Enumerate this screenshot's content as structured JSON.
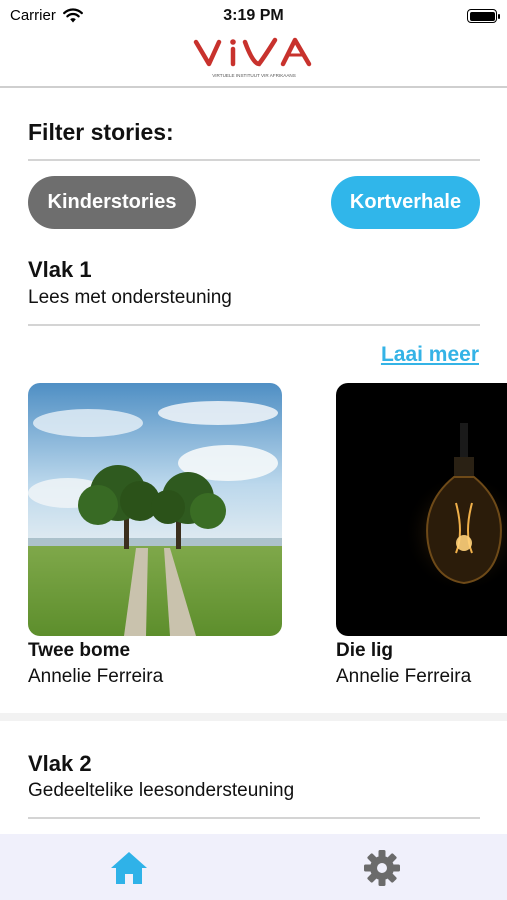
{
  "status_bar": {
    "carrier": "Carrier",
    "time": "3:19 PM",
    "wifi_icon": "wifi-icon",
    "battery_icon": "battery-icon"
  },
  "header": {
    "logo_text": "VIVA",
    "logo_tagline": "VIRTUELE INSTITUUT VIR AFRIKAANS"
  },
  "filter": {
    "title": "Filter stories:",
    "buttons": [
      {
        "label": "Kinderstories",
        "color": "#6e6e6e"
      },
      {
        "label": "Kortverhale",
        "color": "#30b6ea"
      }
    ]
  },
  "sections": [
    {
      "title": "Vlak 1",
      "subtitle": "Lees met ondersteuning",
      "load_more": "Laai meer",
      "stories": [
        {
          "title": "Twee bome",
          "author": "Annelie Ferreira",
          "image": "two-trees-landscape"
        },
        {
          "title": "Die lig",
          "author": "Annelie Ferreira",
          "image": "light-bulb-dark"
        }
      ]
    },
    {
      "title": "Vlak 2",
      "subtitle": "Gedeeltelike leesondersteuning"
    }
  ],
  "tab_bar": {
    "items": [
      {
        "icon": "home-icon",
        "active": true,
        "color": "#2fb2e8"
      },
      {
        "icon": "gear-icon",
        "active": false,
        "color": "#6b6b6b"
      }
    ]
  },
  "colors": {
    "accent": "#30b6ea",
    "logo_red": "#c8322d",
    "pill_gray": "#6e6e6e",
    "tabbar_bg": "#f0f0fb"
  }
}
